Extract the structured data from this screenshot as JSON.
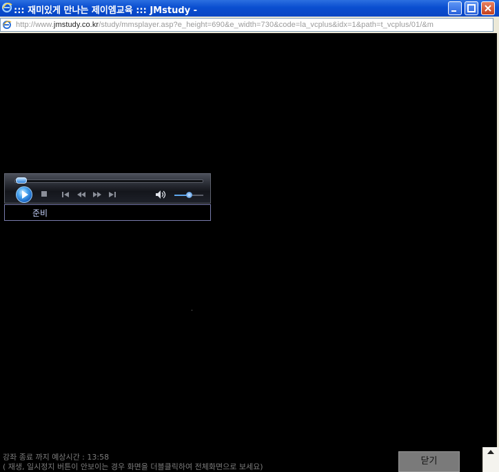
{
  "window": {
    "title": "::: 재미있게 만나는 제이엠교육 ::: JMstudy -",
    "url_prefix": "http://www.",
    "url_domain": "jmstudy.co.kr",
    "url_rest": "/study/mmsplayer.asp?e_height=690&e_width=730&code=la_vcplus&idx=1&path=t_vcplus/01/&m"
  },
  "player": {
    "status_text": "준비",
    "seek_progress": 0.0,
    "volume_level": 0.5,
    "icons": [
      "play-icon",
      "stop-icon",
      "previous-icon",
      "rewind-icon",
      "fast-forward-icon",
      "next-icon",
      "volume-icon"
    ]
  },
  "footer": {
    "line1": "강좌 종료 까지 예상시간 : 13:58",
    "line2": "( 재생, 일시정지 버튼이 안보이는 경우 화면을 더블클릭하여 전체화면으로 보세요)",
    "close_label": "닫기"
  },
  "colors": {
    "titlebar": "#0a4ed0",
    "player_accent": "#4aa6f0",
    "status_text": "#c8d4ff"
  }
}
